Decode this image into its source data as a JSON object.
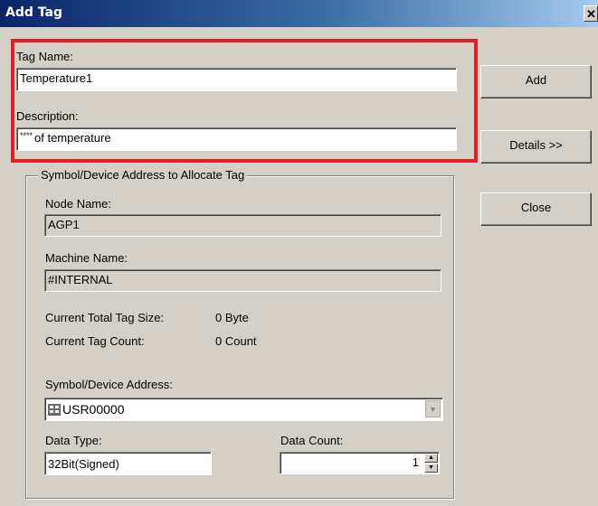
{
  "window": {
    "title": "Add Tag",
    "close_glyph": "✕"
  },
  "tag_name": {
    "label": "Tag Name:",
    "value": "Temperature1"
  },
  "description": {
    "label": "Description:",
    "prefix": "****",
    "value": "of temperature"
  },
  "buttons": {
    "add": "Add",
    "details": "Details >>",
    "close": "Close"
  },
  "group": {
    "title": "Symbol/Device Address to Allocate Tag",
    "node_name": {
      "label": "Node Name:",
      "value": "AGP1"
    },
    "machine_name": {
      "label": "Machine Name:",
      "value": "#INTERNAL"
    },
    "current_total_tag_size": {
      "label": "Current Total Tag Size:",
      "value": "0 Byte"
    },
    "current_tag_count": {
      "label": "Current Tag Count:",
      "value": "0 Count"
    },
    "symbol_device_address": {
      "label": "Symbol/Device Address:",
      "value": "USR00000"
    },
    "data_type": {
      "label": "Data Type:",
      "value": "32Bit(Signed)"
    },
    "data_count": {
      "label": "Data Count:",
      "value": "1"
    }
  },
  "icons": {
    "address_icon": "grid-icon",
    "dropdown": "chevron-down-icon",
    "spin_up": "arrow-up-icon",
    "spin_down": "arrow-down-icon"
  },
  "colors": {
    "highlight_border": "#e21f1f",
    "titlebar_start": "#0a246a",
    "dialog_bg": "#d4d0c8"
  }
}
